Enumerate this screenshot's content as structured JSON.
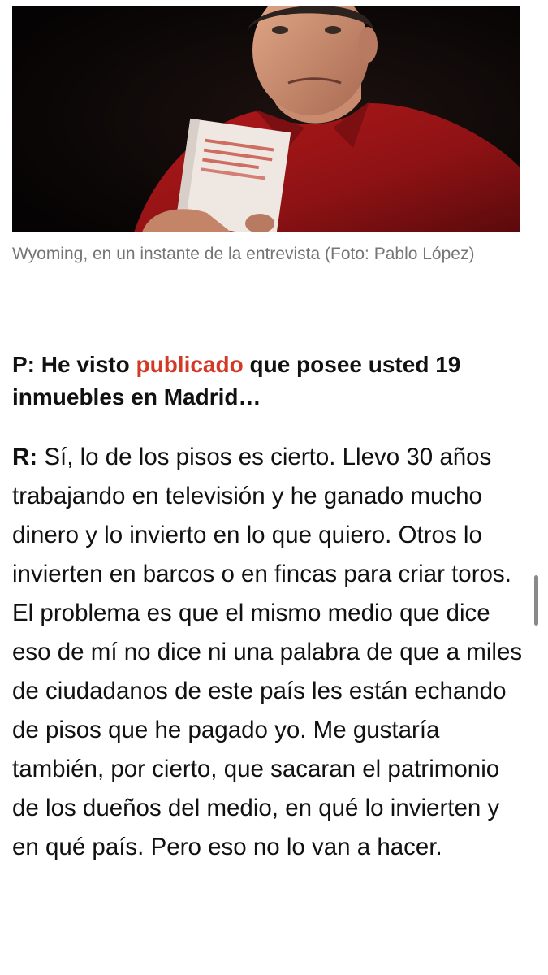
{
  "article": {
    "photo": {
      "subject": "man in red shirt holding a book, dark background"
    },
    "caption": "Wyoming, en un instante de la entrevista (Foto: Pablo López)",
    "question": {
      "prefix": "P:",
      "text_before": " He visto ",
      "link_text": "publicado",
      "text_after": " que posee usted 19 inmuebles en Madrid…"
    },
    "answer": {
      "prefix": "R:",
      "text": " Sí, lo de los pisos es cierto. Llevo 30 años trabajando en televisión y he ganado mucho dinero y lo invierto en lo que quiero. Otros lo invierten en barcos o en fincas para criar toros. El problema es que el mismo medio que dice eso de mí no dice ni una palabra de que a miles de ciudadanos de este país les están echando de pisos que he pagado yo. Me gustaría también, por cierto, que sacaran el patrimonio de los dueños del medio, en qué lo invierten y en qué país. Pero eso no lo van a hacer."
    }
  },
  "colors": {
    "link": "#d23a25",
    "caption": "#757575",
    "body_text": "#111111",
    "photo_background": "#0a0707"
  }
}
